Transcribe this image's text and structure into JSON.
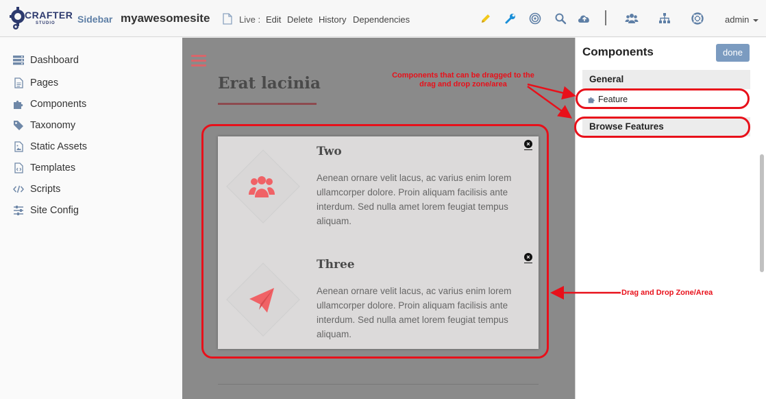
{
  "topbar": {
    "logo_text": "CRAFTER",
    "logo_sub": "STUDIO",
    "sidebar_label": "Sidebar",
    "site_name": "myawesomesite",
    "live_label": "Live :",
    "links": [
      "Edit",
      "Delete",
      "History",
      "Dependencies"
    ],
    "user": "admin"
  },
  "nav": {
    "items": [
      {
        "label": "Dashboard",
        "icon": "dashboard-icon"
      },
      {
        "label": "Pages",
        "icon": "page-icon"
      },
      {
        "label": "Components",
        "icon": "puzzle-icon"
      },
      {
        "label": "Taxonomy",
        "icon": "tag-icon"
      },
      {
        "label": "Static Assets",
        "icon": "image-file-icon"
      },
      {
        "label": "Templates",
        "icon": "code-file-icon"
      },
      {
        "label": "Scripts",
        "icon": "code-icon"
      },
      {
        "label": "Site Config",
        "icon": "sliders-icon"
      }
    ]
  },
  "preview": {
    "heading": "Erat lacinia",
    "features": [
      {
        "title": "Two",
        "icon": "users-icon",
        "body": "Aenean ornare velit lacus, ac varius enim lorem ullamcorper dolore. Proin aliquam facilisis ante interdum. Sed nulla amet lorem feugiat tempus aliquam."
      },
      {
        "title": "Three",
        "icon": "paper-plane-icon",
        "body": "Aenean ornare velit lacus, ac varius enim lorem ullamcorper dolore. Proin aliquam facilisis ante interdum. Sed nulla amet lorem feugiat tempus aliquam."
      }
    ]
  },
  "panel": {
    "title": "Components",
    "done_label": "done",
    "section_general": "General",
    "feature_item": "Feature",
    "section_browse": "Browse Features"
  },
  "annotations": {
    "components_note": "Components that can be dragged to the drag and drop zone/area",
    "dropzone_note": "Drag and Drop Zone/Area"
  },
  "colors": {
    "accent_red": "#e8101a",
    "brand_blue": "#5e7fa6",
    "feature_icon": "#f06266",
    "done_button": "#7b9bc0"
  }
}
